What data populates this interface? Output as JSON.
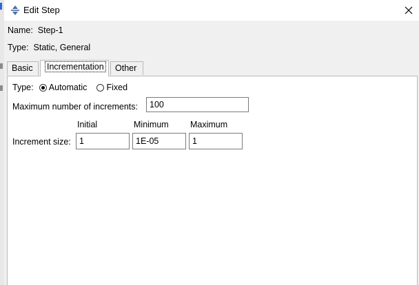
{
  "window": {
    "title": "Edit Step"
  },
  "info": {
    "name_label": "Name:",
    "name_value": "Step-1",
    "type_label": "Type:",
    "type_value": "Static, General"
  },
  "tabs": [
    {
      "label": "Basic"
    },
    {
      "label": "Incrementation"
    },
    {
      "label": "Other"
    }
  ],
  "incrementation": {
    "type_label": "Type:",
    "options": [
      {
        "label": "Automatic",
        "checked": true
      },
      {
        "label": "Fixed",
        "checked": false
      }
    ],
    "max_increments_label": "Maximum number of increments:",
    "max_increments_value": "100",
    "columns": [
      "Initial",
      "Minimum",
      "Maximum"
    ],
    "increment_size_label": "Increment size:",
    "increment_size_values": [
      "1",
      "1E-05",
      "1"
    ]
  },
  "icons": {
    "app": "step-arrows-icon",
    "close": "close-icon"
  }
}
